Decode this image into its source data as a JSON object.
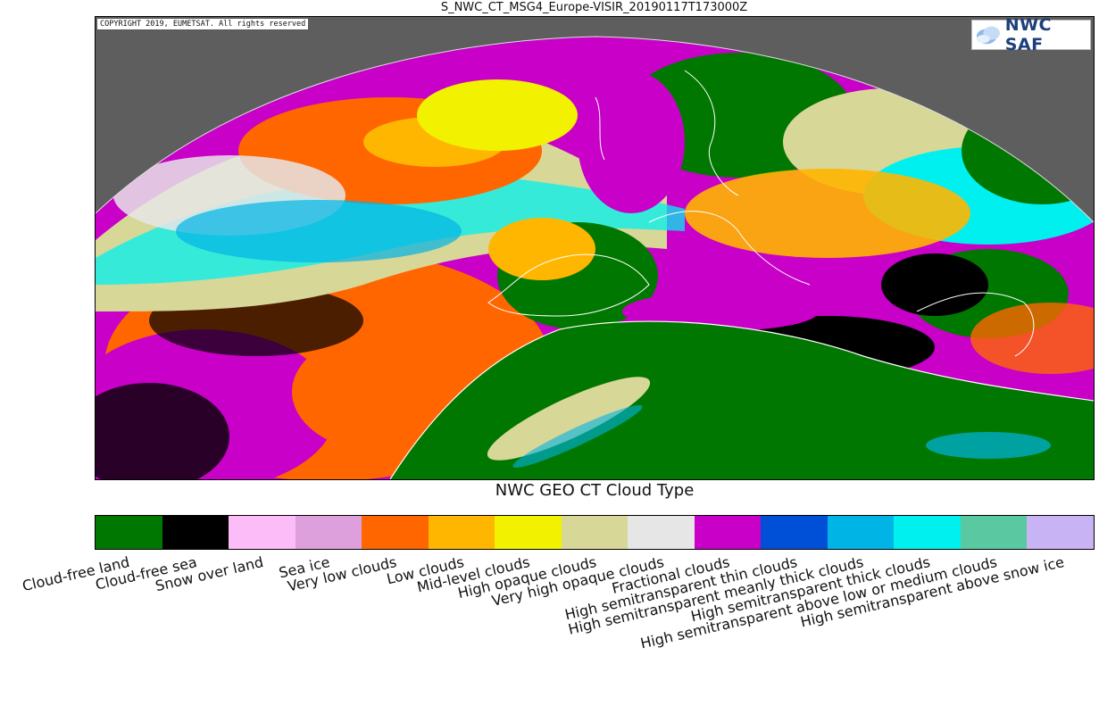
{
  "header": {
    "file_title": "S_NWC_CT_MSG4_Europe-VISIR_20190117T173000Z"
  },
  "map": {
    "copyright": "COPYRIGHT 2019, EUMETSAT. All rights reserved",
    "logo_text": "NWC SAF",
    "space_color": "#5e5e5e",
    "coastline_color": "#ffffff"
  },
  "product": {
    "title": "NWC GEO CT Cloud Type"
  },
  "legend": {
    "categories": [
      {
        "label": "Cloud-free land",
        "color": "#007700"
      },
      {
        "label": "Cloud-free sea",
        "color": "#000000"
      },
      {
        "label": "Snow over land",
        "color": "#fbbcf7"
      },
      {
        "label": "Sea ice",
        "color": "#dda0dd"
      },
      {
        "label": "Very low clouds",
        "color": "#ff6600"
      },
      {
        "label": "Low clouds",
        "color": "#ffb600"
      },
      {
        "label": "Mid-level clouds",
        "color": "#f2f200"
      },
      {
        "label": "High opaque clouds",
        "color": "#d7d797"
      },
      {
        "label": "Very high opaque clouds",
        "color": "#e6e6e6"
      },
      {
        "label": "Fractional clouds",
        "color": "#c800c8"
      },
      {
        "label": "High semitransparent thin clouds",
        "color": "#0050d7"
      },
      {
        "label": "High semitransparent meanly thick clouds",
        "color": "#00b4e6"
      },
      {
        "label": "High semitransparent thick clouds",
        "color": "#00f0f0"
      },
      {
        "label": "High semitransparent above low or medium clouds",
        "color": "#5ac8a0"
      },
      {
        "label": "High semitransparent above snow ice",
        "color": "#c8b4f5"
      }
    ]
  }
}
